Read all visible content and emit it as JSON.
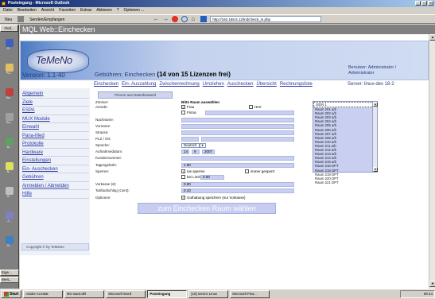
{
  "window": {
    "title": "Posteingang - Microsoft Outlook"
  },
  "menu": [
    "Datei",
    "Bearbeiten",
    "Ansicht",
    "Favoriten",
    "Extras",
    "Aktionen",
    "?",
    "Optionen ..."
  ],
  "toolbar": {
    "new_label": "Neu",
    "sendreceive_label": "Senden/Empfangen",
    "address": "http://192.168.5.12/lnd/check_in.php"
  },
  "outbar": {
    "header": "Outl...",
    "footer1": "Eige...",
    "footer2": "Weit...",
    "items": [
      {
        "label": "O...",
        "color": "#4060c0"
      },
      {
        "label": "Po...",
        "color": "#e0c060"
      },
      {
        "label": "Ka...",
        "color": "#c04040"
      },
      {
        "label": "Ko...",
        "color": "#a0a0a0"
      },
      {
        "label": "A...",
        "color": "#60a060"
      },
      {
        "label": "N...",
        "color": "#e0e060"
      },
      {
        "label": "G...",
        "color": "#c0c0c0"
      },
      {
        "label": "J...",
        "color": "#8080c0"
      },
      {
        "label": "Ö...",
        "color": "#4080c0"
      }
    ]
  },
  "pane_title": "MQL Web::Einchecken",
  "app": {
    "logo": "TeMeNo",
    "version": "Version: 1.1-40",
    "heading_prefix": "Gebühren: Einchecken",
    "heading_bold": "(14 von 15 Lizenzen frei)",
    "user_line1": "Benutzer: Administrator /",
    "user_line2": "Administrator",
    "server": "Server: linux-dev 18-2",
    "topnav": [
      "Einchecken",
      "Ein- Auszahlung",
      "Zwischenrechnung",
      "Umziehen",
      "Auschecken",
      "Übersicht",
      "Rechnungsliste"
    ],
    "sidenav": [
      "Allgemein",
      "Ziele",
      "ESPA",
      "MUX Module",
      "Einwahl",
      "Pana-Med",
      "Protokolle",
      "Hardware",
      "Einstellungen",
      "Ein- Auschecken",
      "Gebühren",
      "Anmelden / Abmelden",
      "Hilfe"
    ],
    "copyright": "Copyright © by TeMeNo",
    "patient_bar": "Person aus Datenbestand",
    "form": {
      "zimmer_label": "Zimmer:",
      "zimmer_value": "Bitte Raum auswählen",
      "anrede_label": "Anrede:",
      "frau": "Frau",
      "herr": "Herr",
      "firma": "Firma",
      "nachname_label": "Nachname:",
      "vorname_label": "Vorname:",
      "strasse_label": "Strasse:",
      "plz_label": "PLZ / Ort:",
      "sprache_label": "Sprache:",
      "sprache_value": "Deutsch",
      "aufnahme_label": "Aufnahmedatum:",
      "day": "14",
      "month": "9",
      "year": "2007",
      "kunden_label": "Kundennummer:",
      "tages_label": "Tagesgebühr:",
      "tages_value": "1.00",
      "sperren_label": "Sperren:",
      "nie_sperren": "nie sperren",
      "immer_gesperrt": "immer gesperrt",
      "bei_limit": "bei Limit",
      "limit_value": "0.00",
      "vorkasse_label": "Vorkasse (€):",
      "vorkasse_value": "0.00",
      "tarif_label": "Tarifaufschlag (Cent):",
      "tarif_value": "0.10",
      "optionen_label": "Optionen:",
      "option_text": "Guthabung speichern (nur Vorkasse)",
      "submit": "zum Einchecken Raum wählen"
    },
    "rooms": [
      "ISDN 1",
      "Raum 201 a/b",
      "Raum 202 a/b",
      "Raum 203 a/b",
      "Raum 204 a/b",
      "Raum 205 a/b",
      "Raum 206 a/b",
      "Raum 207 a/b",
      "Raum 208 a/b",
      "Raum 210 a/b",
      "Raum 211 a/b",
      "Raum 212 a/b",
      "Raum 213 a/b",
      "Raum 214 a/b",
      "Raum 215 a/b",
      "Raum 216 DPT",
      "Raum 218 DPT",
      "Raum 219 DPT",
      "Raum 220 DPT",
      "Raum 221 DPT"
    ]
  },
  "taskbar": {
    "start": "Start",
    "tasks": [
      "Adobe Acrobat",
      "BG-ward.dhl",
      "Microsoft Word",
      "Posteingang",
      "[10] sreenz Linux",
      "Microsoft Pow..."
    ],
    "active_index": 3,
    "clock": "09:14"
  }
}
